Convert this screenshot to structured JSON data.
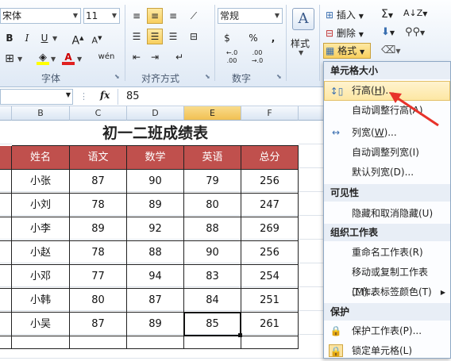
{
  "ribbon": {
    "font_name": "宋体",
    "font_size": "11",
    "bold": "B",
    "italic": "I",
    "underline": "U",
    "grow_font": "A",
    "shrink_font": "A",
    "font_color": "A",
    "phonetic": "wén",
    "group_font": "字体",
    "group_align": "对齐方式",
    "group_number": "数字",
    "number_format": "常规",
    "currency": "$",
    "percent": "%",
    "comma": ",",
    "inc_decimal": "←.0 .00",
    "dec_decimal": ".00 →.0",
    "styles_label": "样式",
    "insert_label": "插入",
    "delete_label": "删除",
    "format_label": "格式",
    "sum": "Σ",
    "sort": "A↓Z",
    "find": "M"
  },
  "formula_bar": {
    "fx": "fx",
    "value": "85"
  },
  "columns": [
    "B",
    "C",
    "D",
    "E",
    "F"
  ],
  "selected_column": "E",
  "sheet": {
    "title": "初一二班成绩表",
    "headers": [
      "姓名",
      "语文",
      "数学",
      "英语",
      "总分"
    ],
    "rows": [
      [
        "小张",
        "87",
        "90",
        "79",
        "256"
      ],
      [
        "小刘",
        "78",
        "89",
        "80",
        "247"
      ],
      [
        "小李",
        "89",
        "92",
        "88",
        "269"
      ],
      [
        "小赵",
        "78",
        "88",
        "90",
        "256"
      ],
      [
        "小邓",
        "77",
        "94",
        "83",
        "254"
      ],
      [
        "小韩",
        "80",
        "87",
        "84",
        "251"
      ],
      [
        "小吴",
        "87",
        "89",
        "85",
        "261"
      ]
    ]
  },
  "menu": {
    "section_cell_size": "单元格大小",
    "row_height": "行高(H)...",
    "row_height_text": "行高(",
    "row_height_key": "H",
    "row_height_tail": ")...",
    "autofit_row": "自动调整行高(A)",
    "col_width_text": "列宽(",
    "col_width_key": "W",
    "col_width_tail": ")...",
    "autofit_col": "自动调整列宽(I)",
    "default_width": "默认列宽(D)...",
    "section_visibility": "可见性",
    "hide_unhide": "隐藏和取消隐藏(U)",
    "section_organize": "组织工作表",
    "rename": "重命名工作表(R)",
    "move_copy": "移动或复制工作表(M)...",
    "tab_color": "工作表标签颜色(T)",
    "section_protect": "保护",
    "protect_sheet": "保护工作表(P)...",
    "lock_cell": "锁定单元格(L)"
  },
  "colors": {
    "header_fill": "#c0504d",
    "arrow": "#e8322a",
    "highlight": "#fde7a3"
  }
}
